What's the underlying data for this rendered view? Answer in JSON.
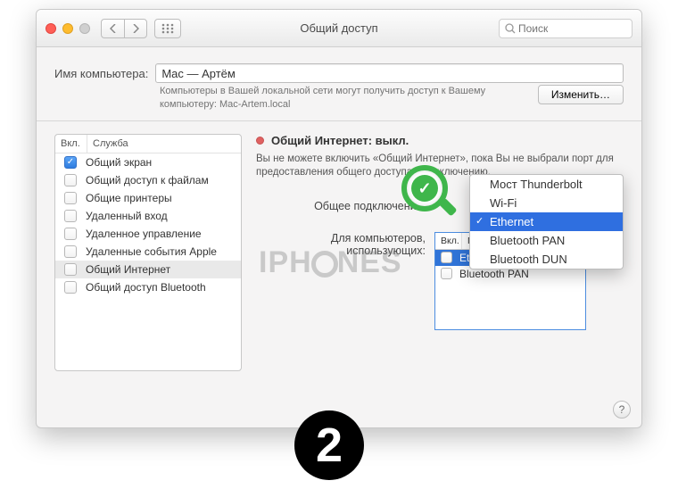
{
  "window": {
    "title": "Общий доступ",
    "search_placeholder": "Поиск"
  },
  "header": {
    "name_label": "Имя компьютера:",
    "name_value": "Mac — Артём",
    "sub_text": "Компьютеры в Вашей локальной сети могут получить доступ к Вашему компьютеру: Mac-Artem.local",
    "edit_button": "Изменить…"
  },
  "services": {
    "col_on": "Вкл.",
    "col_service": "Служба",
    "items": [
      {
        "on": true,
        "label": "Общий экран"
      },
      {
        "on": false,
        "label": "Общий доступ к файлам"
      },
      {
        "on": false,
        "label": "Общие принтеры"
      },
      {
        "on": false,
        "label": "Удаленный вход"
      },
      {
        "on": false,
        "label": "Удаленное управление"
      },
      {
        "on": false,
        "label": "Удаленные события Apple"
      },
      {
        "on": false,
        "label": "Общий Интернет",
        "selected": true
      },
      {
        "on": false,
        "label": "Общий доступ Bluetooth"
      }
    ]
  },
  "main": {
    "status_label": "Общий Интернет: выкл.",
    "desc": "Вы не можете включить «Общий Интернет», пока Вы не выбрали порт для предоставления общего доступа к подключению.",
    "share_from_label": "Общее подключение:",
    "ports_label": "Для компьютеров, использующих:",
    "ports": {
      "col_on": "Вкл.",
      "col_ports": "Порты",
      "items": [
        {
          "on": false,
          "label": "Ethernet",
          "selected": true
        },
        {
          "on": false,
          "label": "Bluetooth PAN"
        }
      ]
    }
  },
  "dropdown": {
    "items": [
      {
        "label": "Мост Thunderbolt"
      },
      {
        "label": "Wi-Fi"
      },
      {
        "label": "Ethernet",
        "selected": true
      },
      {
        "label": "Bluetooth PAN"
      },
      {
        "label": "Bluetooth DUN"
      }
    ]
  },
  "watermark": {
    "a": "IPH",
    "b": "NES"
  },
  "step_number": "2"
}
